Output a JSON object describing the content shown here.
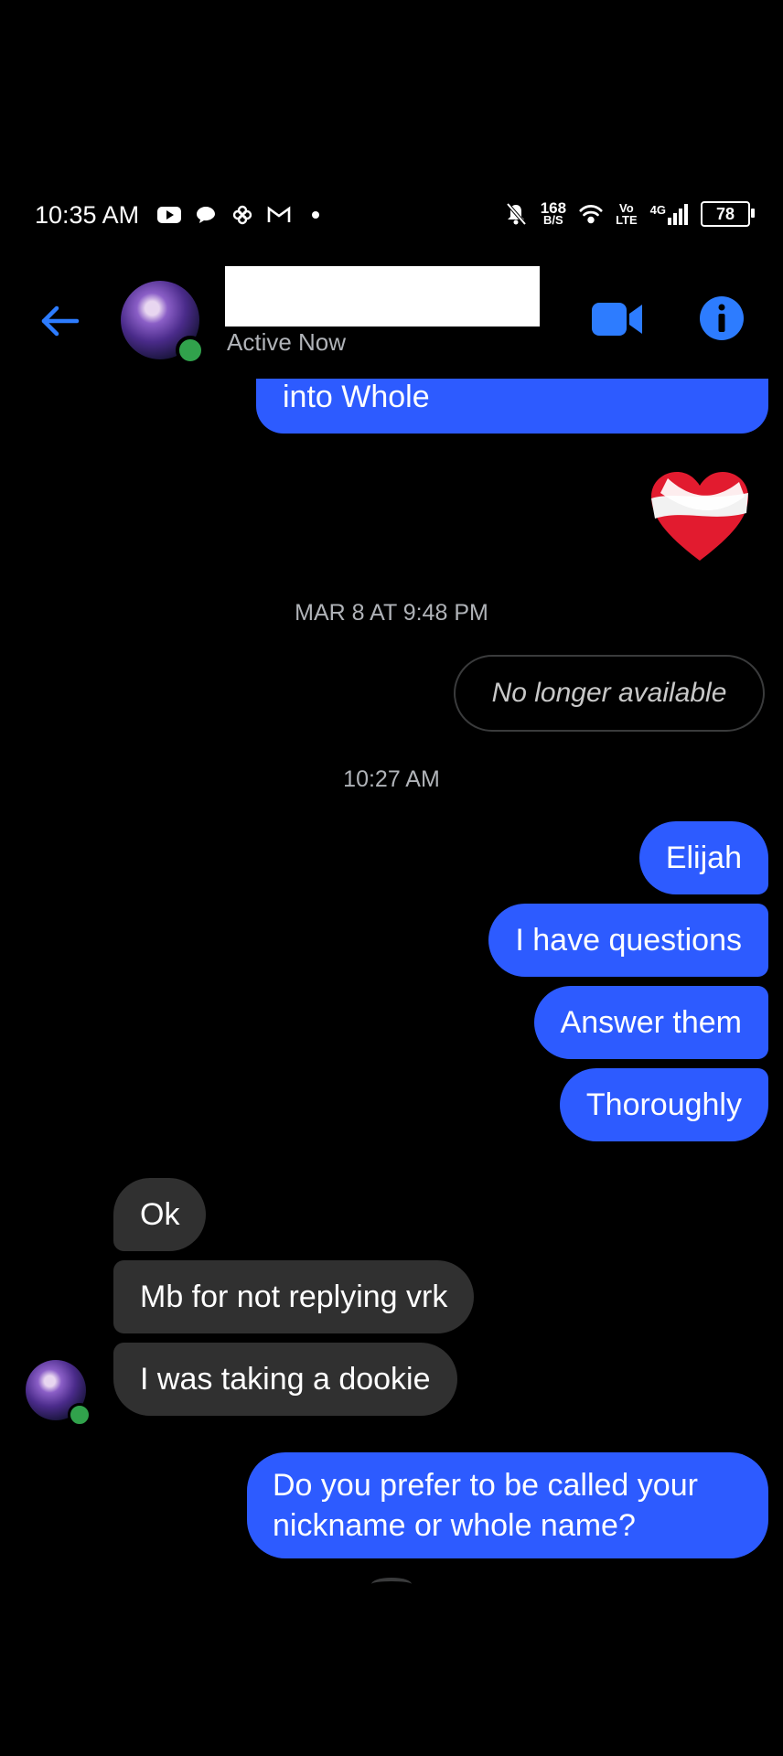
{
  "status_bar": {
    "time": "10:35 AM",
    "net_speed_value": "168",
    "net_speed_unit": "B/S",
    "volte_top": "Vo",
    "volte_bottom": "LTE",
    "network_type": "4G",
    "battery": "78",
    "left_icons": [
      "youtube-icon",
      "chat-icon",
      "pinwheel-icon",
      "gmail-icon",
      "dot-icon"
    ],
    "right_icons": [
      "mute-bell-icon",
      "wifi-icon",
      "signal-icon",
      "battery-icon"
    ]
  },
  "header": {
    "status": "Active Now",
    "accent": "#2d7cff"
  },
  "messages": {
    "partial_sent": "into Whole",
    "reaction_emoji": "mending-heart",
    "timestamp_1": "MAR 8 AT 9:48 PM",
    "unavailable": "No longer available",
    "timestamp_2": "10:27 AM",
    "sent_1": "Elijah",
    "sent_2": "I have questions",
    "sent_3": "Answer them",
    "sent_4": "Thoroughly",
    "recv_1": "Ok",
    "recv_2": "Mb for not replying vrk",
    "recv_3": "I was taking a dookie",
    "sent_5_line1": "Do you prefer to be called your",
    "sent_5_line2": "nickname or whole name?"
  },
  "colors": {
    "sent_bubble": "#2d5bff",
    "received_bubble": "#303030",
    "background": "#000000",
    "online": "#31a24c"
  }
}
